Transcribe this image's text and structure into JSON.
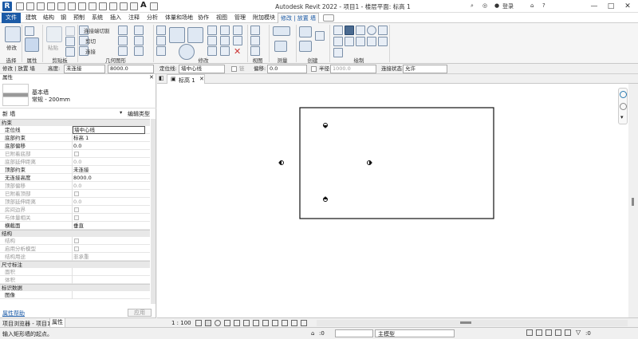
{
  "app": {
    "title": "Autodesk Revit 2022 - 项目1 - 楼层平面: 标高 1",
    "logo": "R",
    "info_icon": "◎",
    "user": "登录",
    "help": "?",
    "min": "—",
    "max": "□",
    "close": "✕"
  },
  "menu": {
    "file": "文件",
    "tabs": [
      "建筑",
      "结构",
      "钢",
      "预制",
      "系统",
      "插入",
      "注释",
      "分析",
      "体量和场地",
      "协作",
      "视图",
      "管理",
      "附加模块",
      "修改 | 放置 墙"
    ]
  },
  "ribbon": {
    "modify": "修改",
    "paste": "粘贴",
    "cut_join": "连接端切割",
    "cut": "剪切",
    "join": "连接",
    "panels": {
      "select": "选择",
      "properties": "属性",
      "clipboard": "剪贴板",
      "geometry": "几何图形",
      "modify": "修改",
      "view": "视图",
      "measure": "测量",
      "create": "创建",
      "draw": "绘制"
    }
  },
  "options": {
    "context": "修改 | 放置 墙",
    "height_label": "高度:",
    "height_mode": "未连接",
    "height_value": "8000.0",
    "location_label": "定位线:",
    "location_value": "墙中心线",
    "chain": "链",
    "offset_label": "偏移:",
    "offset_value": "0.0",
    "radius_label": "半径:",
    "radius_value": "1000.0",
    "join_label": "连接状态:",
    "join_value": "允许"
  },
  "properties": {
    "title": "属性",
    "close": "✕",
    "type_name": "基本墙",
    "type_sub": "常规 - 200mm",
    "instance_label": "新 墙",
    "edit_type": "编辑类型",
    "sections": {
      "constraints": "约束",
      "structure": "结构",
      "dimensions": "尺寸标注",
      "identity": "标识数据"
    },
    "constraints": [
      {
        "k": "定位线",
        "v": "墙中心线"
      },
      {
        "k": "底部约束",
        "v": "标高 1"
      },
      {
        "k": "底部偏移",
        "v": "0.0"
      },
      {
        "k": "已附着底部",
        "v": ""
      },
      {
        "k": "底部延伸距离",
        "v": "0.0"
      },
      {
        "k": "顶部约束",
        "v": "未连接"
      },
      {
        "k": "无连接高度",
        "v": "8000.0"
      },
      {
        "k": "顶部偏移",
        "v": "0.0"
      },
      {
        "k": "已附着顶部",
        "v": ""
      },
      {
        "k": "顶部延伸距离",
        "v": "0.0"
      },
      {
        "k": "房间边界",
        "v": ""
      },
      {
        "k": "与体量相关",
        "v": ""
      },
      {
        "k": "横截面",
        "v": "垂直"
      }
    ],
    "structure_rows": [
      {
        "k": "结构",
        "v": ""
      },
      {
        "k": "启用分析模型",
        "v": ""
      },
      {
        "k": "结构用途",
        "v": "非承重"
      }
    ],
    "dimension_rows": [
      {
        "k": "面积",
        "v": ""
      },
      {
        "k": "体积",
        "v": ""
      }
    ],
    "identity_rows": [
      {
        "k": "图像",
        "v": ""
      }
    ],
    "help_link": "属性帮助",
    "apply": "应用"
  },
  "view": {
    "tab": "标高 1",
    "scale": "1 : 100"
  },
  "bottom_tabs": {
    "browser": "项目浏览器 - 项目1",
    "props": "属性"
  },
  "status": {
    "hint": "输入矩形墙的起点。",
    "zero": ":0",
    "model": "主模型"
  }
}
